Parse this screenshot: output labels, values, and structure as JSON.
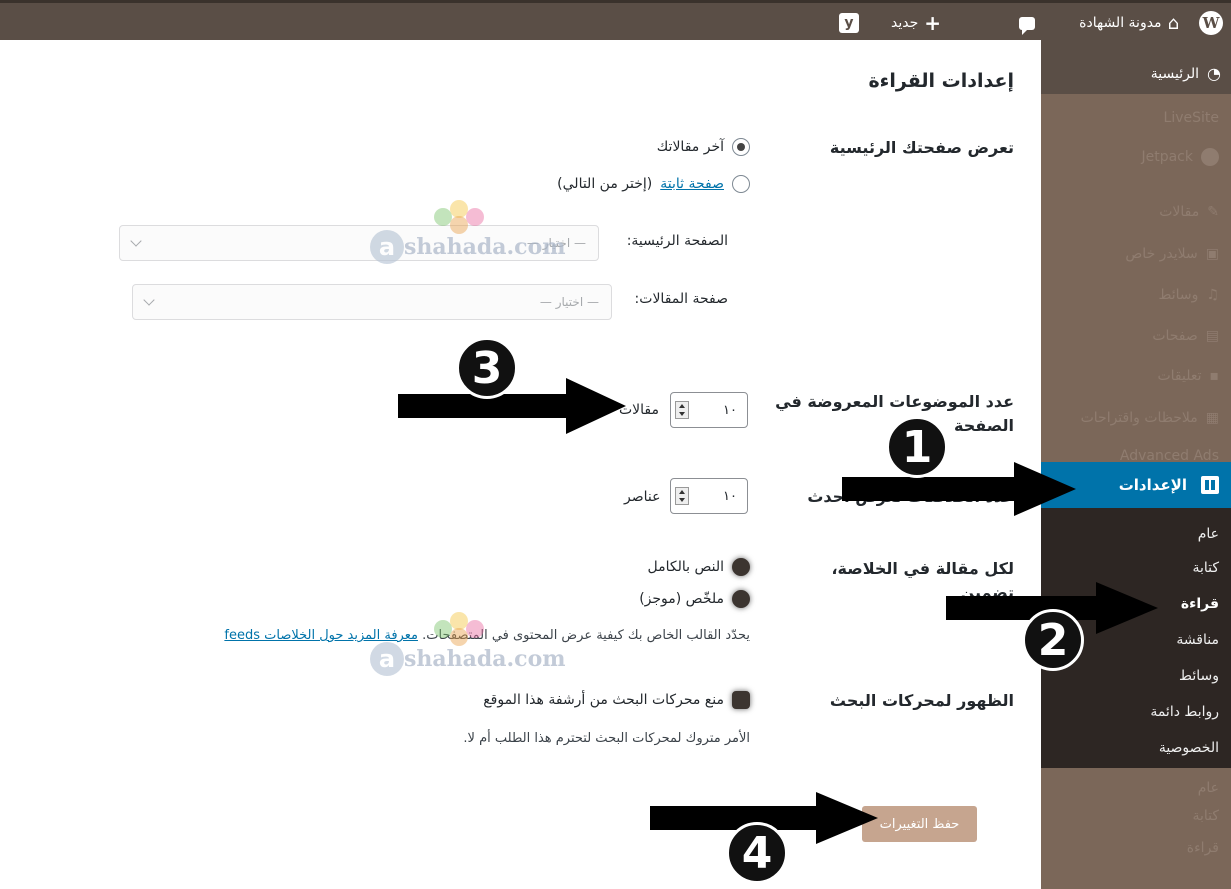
{
  "adminbar": {
    "site_name": "مدونة الشهادة",
    "new_label": "جديد",
    "yoast_label": "y"
  },
  "sidebar": {
    "dashboard": "الرئيسية",
    "faded_items": [
      "LiveSite",
      "Jetpack",
      "مقالات",
      "سلايدر خاص",
      "وسائط",
      "صفحات",
      "تعليقات",
      "ملاحظات واقتراحات",
      "Advanced Ads"
    ],
    "settings": "الإعدادات",
    "submenu": [
      "عام",
      "كتابة",
      "قراءة",
      "مناقشة",
      "وسائط",
      "روابط دائمة",
      "الخصوصية"
    ],
    "below": [
      "عام",
      "كتابة",
      "قراءة"
    ]
  },
  "page": {
    "title": "إعدادات القراءة",
    "front_page_heading": "تعرض صفحتك الرئيسية",
    "option_latest": "آخر مقالاتك",
    "option_static_link": "صفحة ثابتة",
    "option_static_suffix": "(إختر من التالي)",
    "homepage_label": "الصفحة الرئيسية:",
    "homepage_select": "— اختيار —",
    "posts_page_label": "صفحة المقالات:",
    "posts_page_select": "— اختيار —",
    "posts_per_page_heading": "عدد الموضوعات المعروضة في الصفحة",
    "posts_per_page_value": "١٠",
    "posts_per_page_unit": "مقالات",
    "feeds_heading": "عدد الخلاصات تعرض أحدث",
    "feeds_value": "١٠",
    "feeds_unit": "عناصر",
    "feed_content_heading": "لكل مقالة في الخلاصة، تضمين",
    "option_full_text": "النص بالكامل",
    "option_summary": "ملخّص (موجز)",
    "feed_desc_text": "يحدّد القالب الخاص بك كيفية عرض المحتوى في المتصفحات.",
    "feed_desc_link": "معرفة المزيد حول الخلاصات feeds",
    "search_heading": "الظهور لمحركات البحث",
    "search_checkbox_label": "منع محركات البحث من أرشفة هذا الموقع",
    "search_desc": "الأمر متروك لمحركات البحث لتحترم هذا الطلب أم لا.",
    "save_button": "حفظ التغييرات"
  },
  "watermark": {
    "letter": "a",
    "text": "shahada.com"
  },
  "annotations": {
    "badge_1": "1",
    "badge_2": "2",
    "badge_3": "3",
    "badge_4": "4"
  },
  "colors": {
    "adminbar": "#5a4e46",
    "sidebar": "#7b6759",
    "settings_active": "#0073aa",
    "submenu": "#2d2623",
    "save_button": "#c6a58f"
  }
}
